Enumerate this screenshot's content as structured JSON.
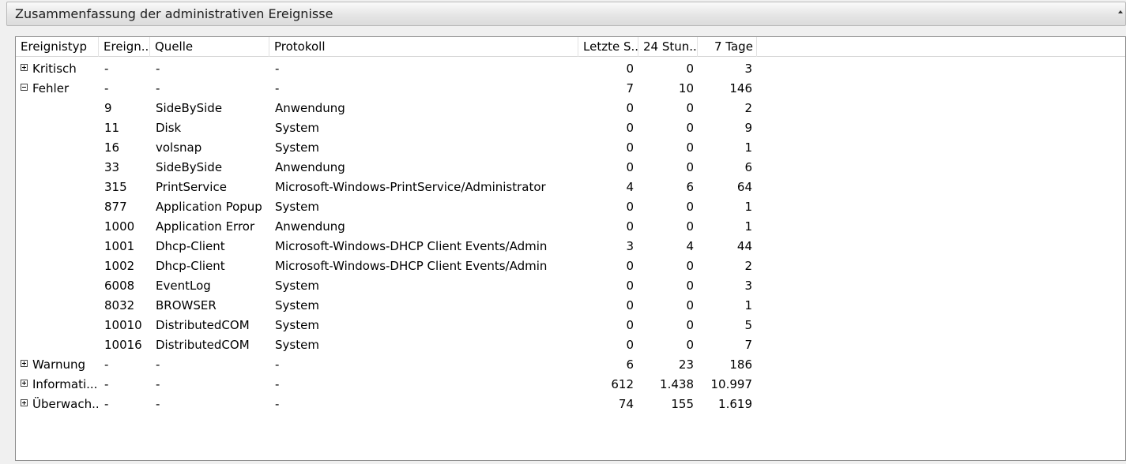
{
  "panel": {
    "title": "Zusammenfassung der administrativen Ereignisse"
  },
  "columns": {
    "type": "Ereignistyp",
    "id": "Ereign...",
    "source": "Quelle",
    "log": "Protokoll",
    "last": "Letzte S...",
    "h24": "24 Stun...",
    "d7": "7 Tage"
  },
  "rows": [
    {
      "type": "Kritisch",
      "expander": "plus",
      "id": "-",
      "source": "-",
      "log": "-",
      "last": "0",
      "h24": "0",
      "d7": "3"
    },
    {
      "type": "Fehler",
      "expander": "minus",
      "id": "-",
      "source": "-",
      "log": "-",
      "last": "7",
      "h24": "10",
      "d7": "146"
    },
    {
      "type": "",
      "expander": "",
      "id": "9",
      "source": "SideBySide",
      "log": "Anwendung",
      "last": "0",
      "h24": "0",
      "d7": "2"
    },
    {
      "type": "",
      "expander": "",
      "id": "11",
      "source": "Disk",
      "log": "System",
      "last": "0",
      "h24": "0",
      "d7": "9"
    },
    {
      "type": "",
      "expander": "",
      "id": "16",
      "source": "volsnap",
      "log": "System",
      "last": "0",
      "h24": "0",
      "d7": "1"
    },
    {
      "type": "",
      "expander": "",
      "id": "33",
      "source": "SideBySide",
      "log": "Anwendung",
      "last": "0",
      "h24": "0",
      "d7": "6"
    },
    {
      "type": "",
      "expander": "",
      "id": "315",
      "source": "PrintService",
      "log": "Microsoft-Windows-PrintService/Administrator",
      "last": "4",
      "h24": "6",
      "d7": "64"
    },
    {
      "type": "",
      "expander": "",
      "id": "877",
      "source": "Application Popup",
      "log": "System",
      "last": "0",
      "h24": "0",
      "d7": "1"
    },
    {
      "type": "",
      "expander": "",
      "id": "1000",
      "source": "Application Error",
      "log": "Anwendung",
      "last": "0",
      "h24": "0",
      "d7": "1"
    },
    {
      "type": "",
      "expander": "",
      "id": "1001",
      "source": "Dhcp-Client",
      "log": "Microsoft-Windows-DHCP Client Events/Admin",
      "last": "3",
      "h24": "4",
      "d7": "44"
    },
    {
      "type": "",
      "expander": "",
      "id": "1002",
      "source": "Dhcp-Client",
      "log": "Microsoft-Windows-DHCP Client Events/Admin",
      "last": "0",
      "h24": "0",
      "d7": "2"
    },
    {
      "type": "",
      "expander": "",
      "id": "6008",
      "source": "EventLog",
      "log": "System",
      "last": "0",
      "h24": "0",
      "d7": "3"
    },
    {
      "type": "",
      "expander": "",
      "id": "8032",
      "source": "BROWSER",
      "log": "System",
      "last": "0",
      "h24": "0",
      "d7": "1"
    },
    {
      "type": "",
      "expander": "",
      "id": "10010",
      "source": "DistributedCOM",
      "log": "System",
      "last": "0",
      "h24": "0",
      "d7": "5"
    },
    {
      "type": "",
      "expander": "",
      "id": "10016",
      "source": "DistributedCOM",
      "log": "System",
      "last": "0",
      "h24": "0",
      "d7": "7"
    },
    {
      "type": "Warnung",
      "expander": "plus",
      "id": "-",
      "source": "-",
      "log": "-",
      "last": "6",
      "h24": "23",
      "d7": "186"
    },
    {
      "type": "Informati...",
      "expander": "plus",
      "id": "-",
      "source": "-",
      "log": "-",
      "last": "612",
      "h24": "1.438",
      "d7": "10.997"
    },
    {
      "type": "Überwach...",
      "expander": "plus",
      "id": "-",
      "source": "-",
      "log": "-",
      "last": "74",
      "h24": "155",
      "d7": "1.619"
    }
  ]
}
